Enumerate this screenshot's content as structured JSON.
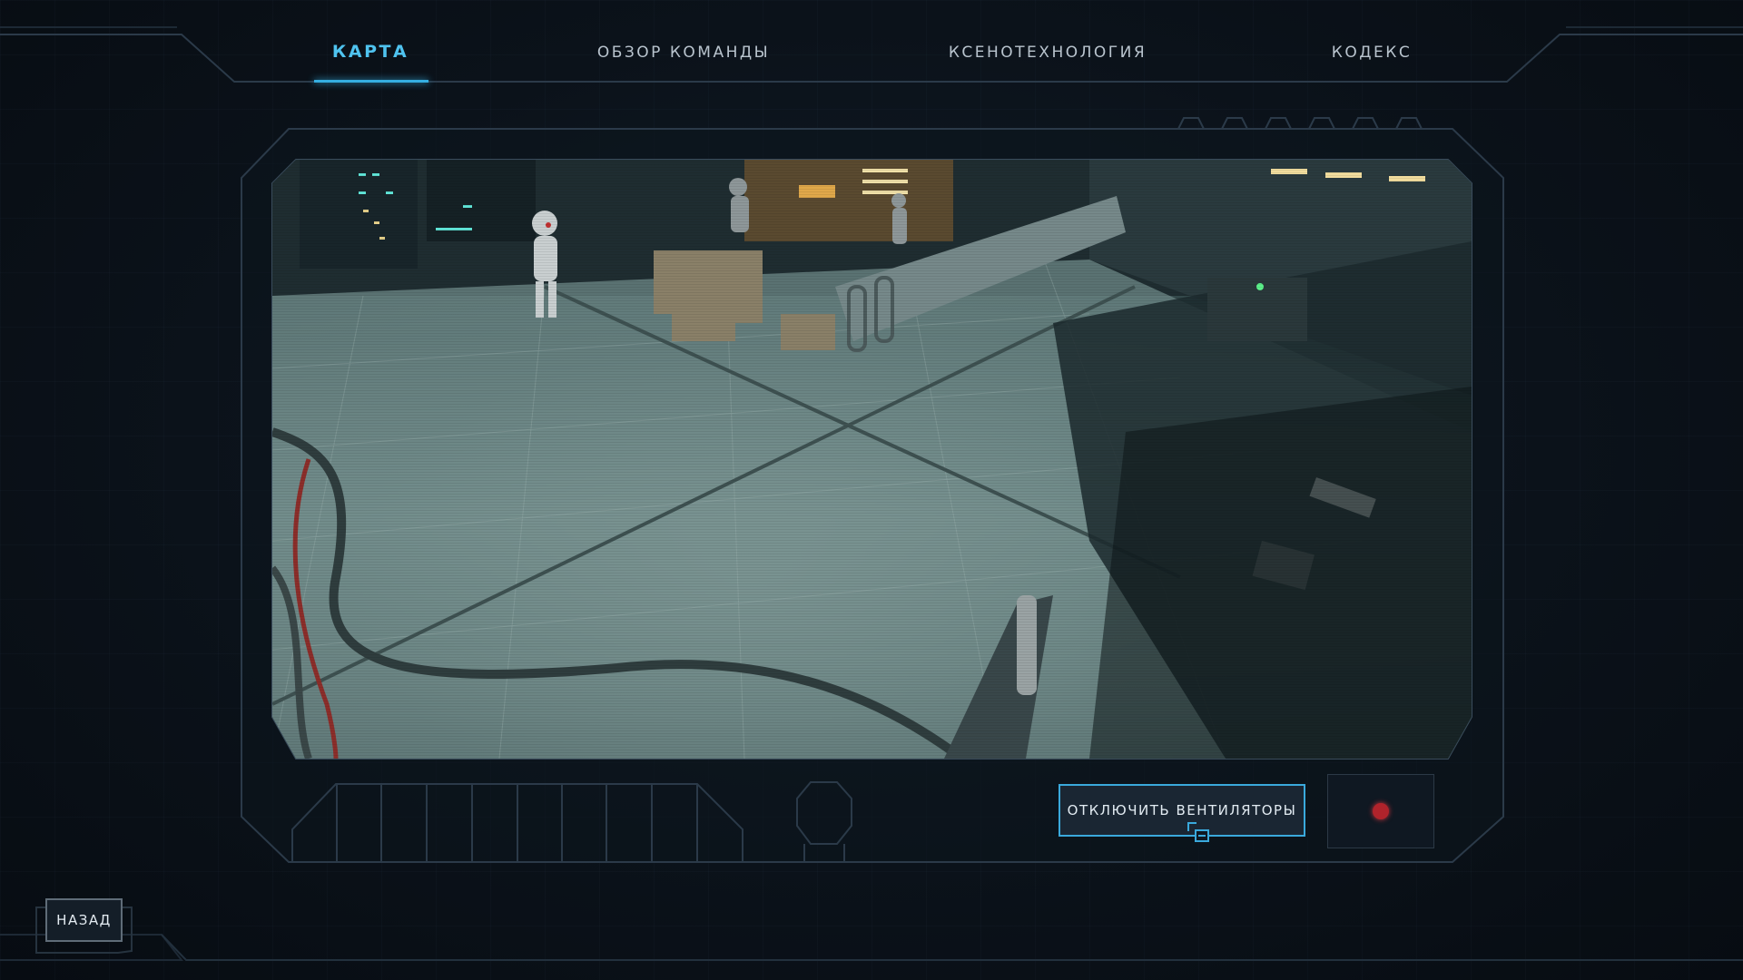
{
  "nav": {
    "tabs": [
      {
        "label": "КАРТА",
        "active": true
      },
      {
        "label": "ОБЗОР КОМАНДЫ",
        "active": false
      },
      {
        "label": "КСЕНОТЕХНОЛОГИЯ",
        "active": false
      },
      {
        "label": "КОДЕКС",
        "active": false
      }
    ]
  },
  "camera_feed": {
    "status": "recording",
    "recording_indicator_color": "#b0232b"
  },
  "actions": {
    "primary_label": "ОТКЛЮЧИТЬ ВЕНТИЛЯТОРЫ"
  },
  "footer": {
    "back_label": "НАЗАД"
  },
  "colors": {
    "accent": "#4fc3ef",
    "frame_line": "#2b3a49",
    "background": "#0b121a"
  }
}
